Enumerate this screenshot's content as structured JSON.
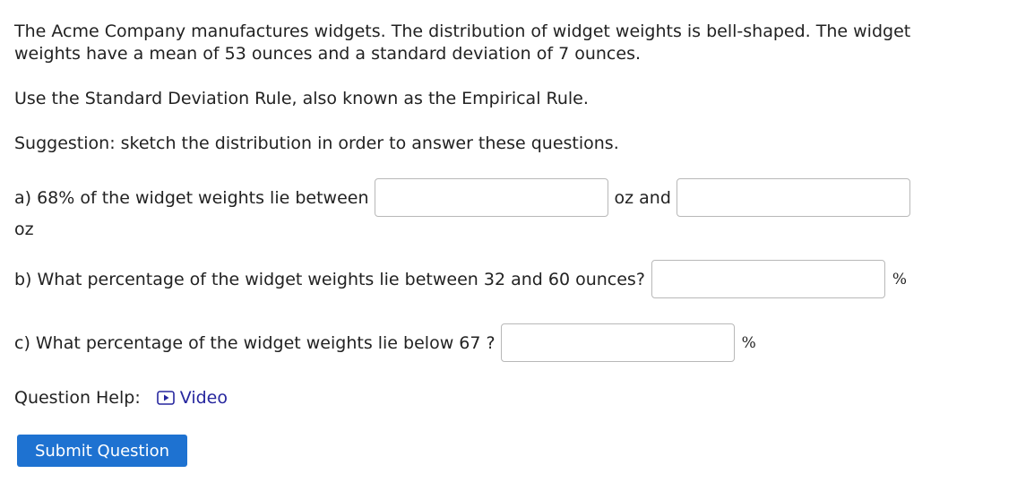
{
  "problem": {
    "intro_line1": "The Acme Company manufactures widgets. The distribution of widget weights is bell-shaped. The widget",
    "intro_line2": "weights have a mean of 53 ounces and a standard deviation of 7 ounces.",
    "instruction": "Use the Standard Deviation Rule, also known as the Empirical Rule.",
    "suggestion": "Suggestion: sketch the distribution in order to answer these questions."
  },
  "part_a": {
    "prefix": "a) 68% of the widget weights lie between",
    "between_label": "oz and",
    "unit_label": "oz",
    "input1_value": "",
    "input2_value": ""
  },
  "part_b": {
    "question": "b) What percentage of the widget weights lie between 32 and 60 ounces?",
    "input_value": "",
    "unit": "%"
  },
  "part_c": {
    "question": "c) What percentage of the widget weights lie below 67 ?",
    "input_value": "",
    "unit": "%"
  },
  "help": {
    "label": "Question Help:",
    "video_label": "Video",
    "video_icon": "play-icon"
  },
  "submit": {
    "label": "Submit Question"
  },
  "colors": {
    "link": "#26269e",
    "button": "#1e72d1",
    "text": "#222222"
  }
}
